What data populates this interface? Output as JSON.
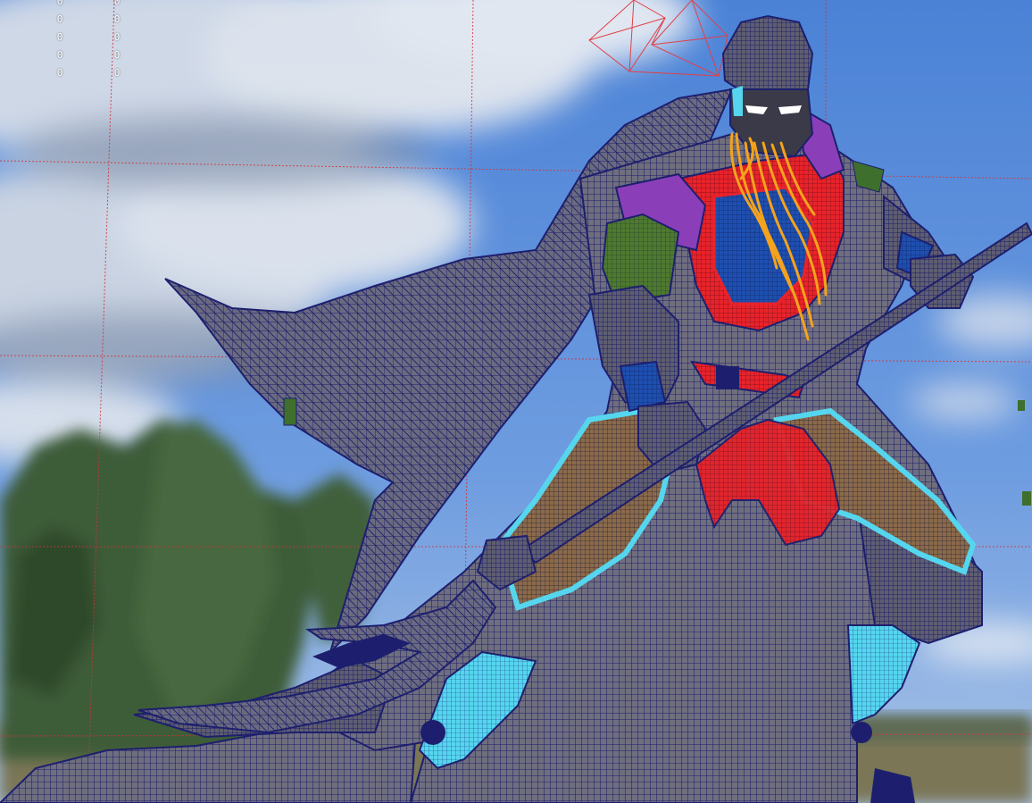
{
  "viewport": {
    "camera": "perspective",
    "display_mode": "wireframe-on-shaded",
    "grid_color": "#d0343a",
    "wire_color": "#1d1f6e",
    "sky_top": "#4f86d8",
    "sky_bottom": "#8fb4e6",
    "cloud_color": "#e8edf4",
    "tree_color": "#3f5e3a",
    "ground_color": "#6e6a50"
  },
  "hud": {
    "stats_col_1": [
      "0",
      "0",
      "0",
      "0",
      "0"
    ],
    "stats_col_2": [
      "0",
      "0",
      "0",
      "0",
      "0"
    ]
  },
  "model": {
    "material_colors": {
      "robe": "#6f6e7e",
      "armor_red": "#e8232a",
      "armor_blue": "#1e4fb0",
      "armor_purple": "#8a3fb8",
      "trim_cyan": "#55d6ee",
      "beard": "#f4a31c",
      "sleeve_green": "#4e7a30",
      "skirt_brown": "#8a6a4a",
      "face": "#3a3a48"
    }
  }
}
